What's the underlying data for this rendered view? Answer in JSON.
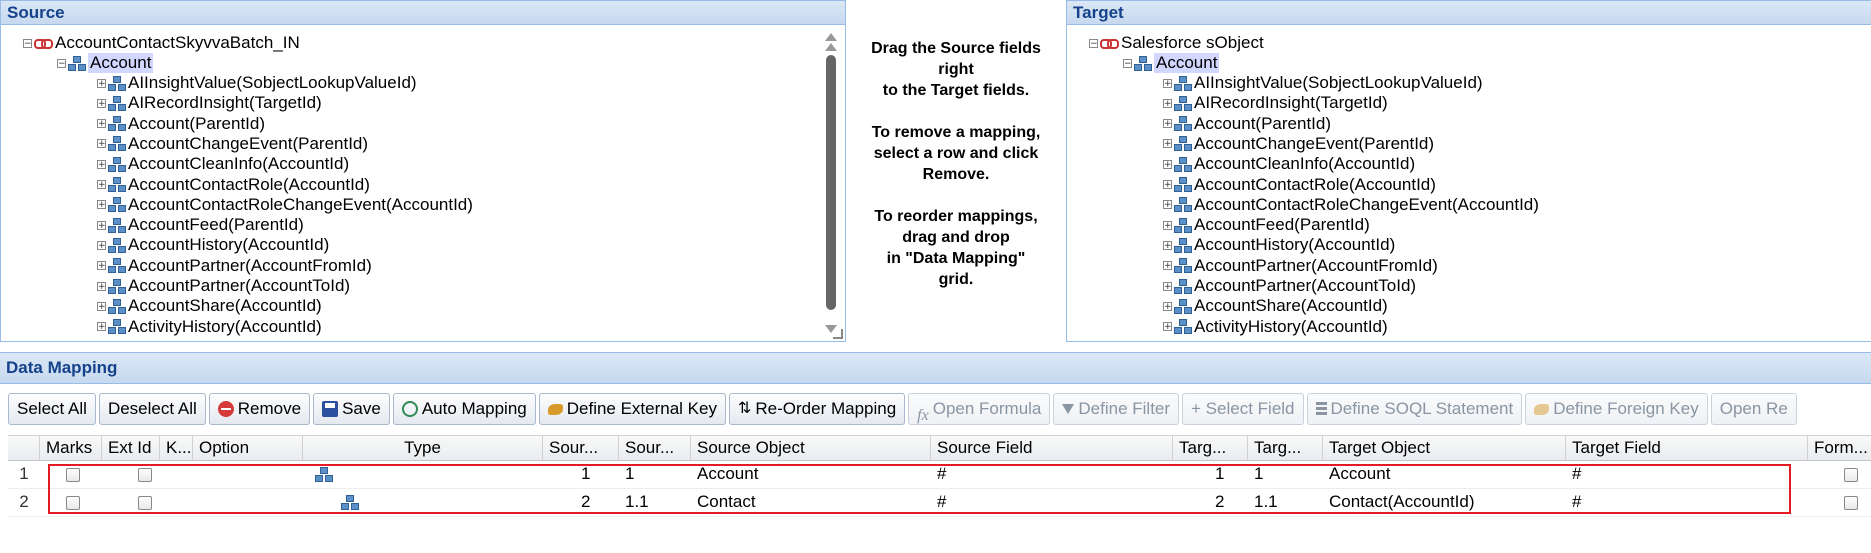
{
  "source": {
    "title": "Source",
    "root": "AccountContactSkyvvaBatch_IN",
    "object": "Account",
    "fields": [
      "AIInsightValue(SobjectLookupValueId)",
      "AIRecordInsight(TargetId)",
      "Account(ParentId)",
      "AccountChangeEvent(ParentId)",
      "AccountCleanInfo(AccountId)",
      "AccountContactRole(AccountId)",
      "AccountContactRoleChangeEvent(AccountId)",
      "AccountFeed(ParentId)",
      "AccountHistory(AccountId)",
      "AccountPartner(AccountFromId)",
      "AccountPartner(AccountToId)",
      "AccountShare(AccountId)",
      "ActivityHistory(AccountId)"
    ]
  },
  "target": {
    "title": "Target",
    "root": "Salesforce sObject",
    "object": "Account",
    "fields": [
      "AIInsightValue(SobjectLookupValueId)",
      "AIRecordInsight(TargetId)",
      "Account(ParentId)",
      "AccountChangeEvent(ParentId)",
      "AccountCleanInfo(AccountId)",
      "AccountContactRole(AccountId)",
      "AccountContactRoleChangeEvent(AccountId)",
      "AccountFeed(ParentId)",
      "AccountHistory(AccountId)",
      "AccountPartner(AccountFromId)",
      "AccountPartner(AccountToId)",
      "AccountShare(AccountId)",
      "ActivityHistory(AccountId)"
    ]
  },
  "help_text": "Drag the Source fields\nright\nto the Target fields.\n\nTo remove a mapping,\nselect a row and click\nRemove.\n\nTo reorder mappings,\ndrag and drop\nin \"Data Mapping\"\ngrid.",
  "data_mapping": {
    "title": "Data Mapping",
    "toolbar": {
      "select_all": "Select All",
      "deselect_all": "Deselect All",
      "remove": "Remove",
      "save": "Save",
      "auto_mapping": "Auto Mapping",
      "define_external_key": "Define External Key",
      "reorder_mapping": "Re-Order Mapping",
      "open_formula": "Open Formula",
      "define_filter": "Define Filter",
      "select_field": "+ Select Field",
      "define_soql": "Define SOQL Statement",
      "define_foreign_key": "Define Foreign Key",
      "open_re": "Open Re"
    },
    "columns": [
      "Marks",
      "Ext Id",
      "K...",
      "Option",
      "Type",
      "Sour...",
      "Sour...",
      "Source Object",
      "Source Field",
      "Targ...",
      "Targ...",
      "Target Object",
      "Target Field",
      "Form..."
    ],
    "rows": [
      {
        "num": "1",
        "source_seq": "1",
        "source_path": "1",
        "source_object": "Account",
        "source_field": "#",
        "target_seq": "1",
        "target_path": "1",
        "target_object": "Account",
        "target_field": "#"
      },
      {
        "num": "2",
        "source_seq": "2",
        "source_path": "1.1",
        "source_object": "Contact",
        "source_field": "#",
        "target_seq": "2",
        "target_path": "1.1",
        "target_object": "Contact(AccountId)",
        "target_field": "#"
      }
    ]
  },
  "colors": {
    "header_text": "#15428b",
    "border": "#99bbe8",
    "highlight": "#e41b23"
  }
}
